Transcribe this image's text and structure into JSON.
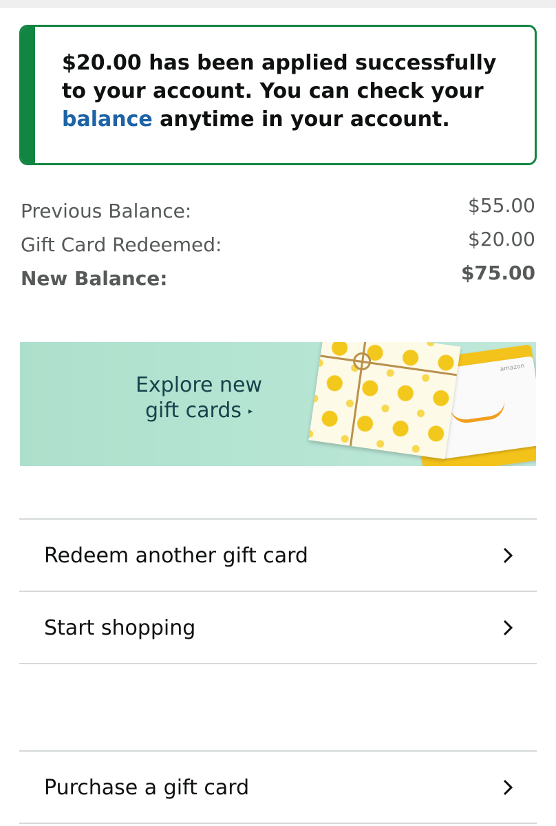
{
  "alert": {
    "message_before_link": "$20.00 has been applied successfully to your account. You can check your ",
    "link_text": "balance",
    "message_after_link": " anytime in your account.",
    "accent_color": "#138542",
    "link_color": "#1d63a6"
  },
  "summary": {
    "rows": [
      {
        "label": "Previous Balance:",
        "amount": "$55.00"
      },
      {
        "label": "Gift Card Redeemed:",
        "amount": "$20.00"
      },
      {
        "label": "New Balance:",
        "amount": "$75.00"
      }
    ]
  },
  "banner": {
    "line1": "Explore new",
    "line2": "gift cards",
    "caret": "▸",
    "card_brand": "amazon"
  },
  "actions": [
    {
      "label": "Redeem another gift card",
      "icon": "chevron-right-icon"
    },
    {
      "label": "Start shopping",
      "icon": "chevron-right-icon"
    },
    {
      "label": "Purchase a gift card",
      "icon": "chevron-right-icon"
    }
  ]
}
